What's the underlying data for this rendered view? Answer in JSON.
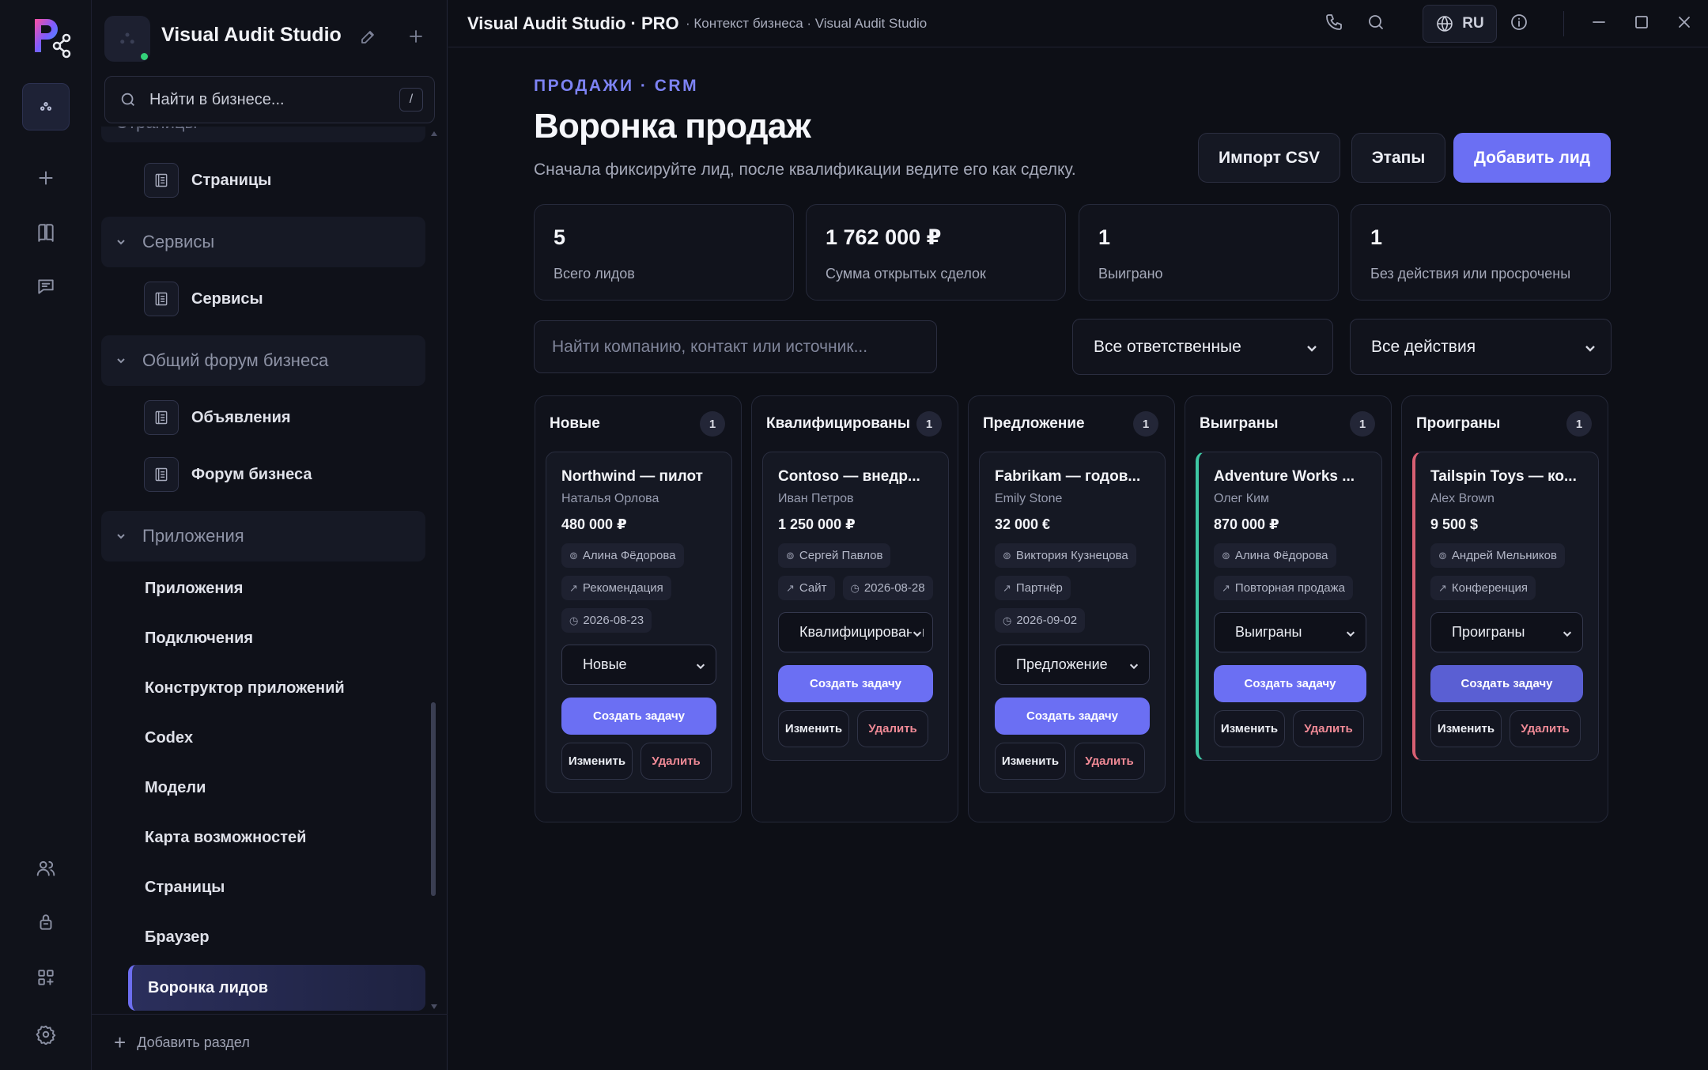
{
  "window": {
    "app_title": "Visual Audit Studio · PRO",
    "context": "· Контекст бизнеса · Visual Audit Studio",
    "language": "RU"
  },
  "rail": {
    "items": [
      "logo-icon",
      "workspace-icon",
      "plus-icon",
      "book-icon",
      "chat-icon",
      "users-icon",
      "lock-icon",
      "apps-icon",
      "settings-icon"
    ]
  },
  "sidebar": {
    "workspace_title": "Visual Audit Studio",
    "search_placeholder": "Найти в бизнесе...",
    "search_shortcut": "/",
    "partial_heading": "Страницы",
    "sections": [
      {
        "title": "Страницы",
        "items": [
          "Страницы"
        ]
      },
      {
        "title": "Сервисы",
        "items": [
          "Сервисы"
        ]
      },
      {
        "title": "Общий форум бизнеса",
        "items": [
          "Объявления",
          "Форум бизнеса"
        ]
      },
      {
        "title": "Приложения",
        "items": [
          "Приложения",
          "Подключения",
          "Конструктор приложений",
          "Codex",
          "Модели",
          "Карта возможностей",
          "Страницы",
          "Браузер",
          "Воронка лидов"
        ]
      }
    ],
    "active_item": "Воронка лидов",
    "add_section": "Добавить раздел"
  },
  "header": {
    "eyebrow": "ПРОДАЖИ · CRM",
    "title": "Воронка продаж",
    "subtitle": "Сначала фиксируйте лид, после квалификации ведите его как сделку.",
    "buttons": {
      "import": "Импорт CSV",
      "stages": "Этапы",
      "add": "Добавить лид"
    }
  },
  "stats": [
    {
      "value": "5",
      "label": "Всего лидов"
    },
    {
      "value": "1 762 000 ₽",
      "label": "Сумма открытых сделок"
    },
    {
      "value": "1",
      "label": "Выиграно"
    },
    {
      "value": "1",
      "label": "Без действия или просрочены"
    }
  ],
  "filters": {
    "search_placeholder": "Найти компанию, контакт или источник...",
    "owner": "Все ответственные",
    "action": "Все действия"
  },
  "board": {
    "columns": [
      {
        "title": "Новые",
        "count": "1",
        "card": {
          "title": "Northwind — пилот",
          "contact": "Наталья Орлова",
          "amount": "480 000 ₽",
          "owner": "Алина Фёдорова",
          "source": "Рекомендация",
          "date": "2026-08-23",
          "stage": "Новые",
          "task": "Создать задачу",
          "edit": "Изменить",
          "delete": "Удалить"
        }
      },
      {
        "title": "Квалифицированы",
        "count": "1",
        "card": {
          "title": "Contoso — внедр...",
          "contact": "Иван Петров",
          "amount": "1 250 000 ₽",
          "owner": "Сергей Павлов",
          "source": "Сайт",
          "date": "2026-08-28",
          "stage": "Квалифицированы",
          "task": "Создать задачу",
          "edit": "Изменить",
          "delete": "Удалить"
        }
      },
      {
        "title": "Предложение",
        "count": "1",
        "card": {
          "title": "Fabrikam — годов...",
          "contact": "Emily Stone",
          "amount": "32 000 €",
          "owner": "Виктория Кузнецова",
          "source": "Партнёр",
          "date": "2026-09-02",
          "stage": "Предложение",
          "task": "Создать задачу",
          "edit": "Изменить",
          "delete": "Удалить"
        }
      },
      {
        "title": "Выиграны",
        "count": "1",
        "card": {
          "title": "Adventure Works ...",
          "contact": "Олег Ким",
          "amount": "870 000 ₽",
          "owner": "Алина Фёдорова",
          "source": "Повторная продажа",
          "stage": "Выиграны",
          "task": "Создать задачу",
          "edit": "Изменить",
          "delete": "Удалить"
        }
      },
      {
        "title": "Проиграны",
        "count": "1",
        "card": {
          "title": "Tailspin Toys — ко...",
          "contact": "Alex Brown",
          "amount": "9 500 $",
          "owner": "Андрей Мельников",
          "source": "Конференция",
          "stage": "Проиграны",
          "task": "Создать задачу",
          "edit": "Изменить",
          "delete": "Удалить"
        }
      }
    ]
  },
  "colors": {
    "accent": "#6b6ff3",
    "won": "#3ec7a3",
    "lost": "#d65f72",
    "background": "#0d0f16"
  }
}
